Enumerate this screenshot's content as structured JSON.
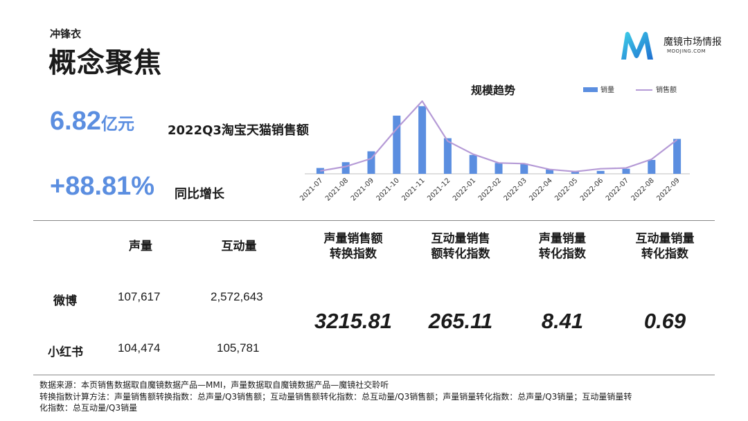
{
  "header": {
    "subtitle": "冲锋衣",
    "title": "概念聚焦",
    "logo_name": "魔镜市场情报",
    "logo_url": "MOOJING.COM",
    "logo_icon": "moojing-m-logo"
  },
  "kpis": {
    "sales_value": "6.82",
    "sales_unit": "亿元",
    "sales_label": "2022Q3淘宝天猫销售额",
    "growth_value": "+88.81%",
    "growth_label": "同比增长"
  },
  "chart_data": {
    "type": "bar",
    "title": "规模趋势",
    "legend_position": "top-right",
    "grid": false,
    "categories": [
      "2021-07",
      "2021-08",
      "2021-09",
      "2021-10",
      "2021-11",
      "2021-12",
      "2022-01",
      "2022-02",
      "2022-03",
      "2022-04",
      "2022-05",
      "2022-06",
      "2022-07",
      "2022-08",
      "2022-09"
    ],
    "ylim": [
      0,
      100
    ],
    "series": [
      {
        "name": "销量",
        "kind": "bar",
        "color": "#5b8ee0",
        "values": [
          8,
          16,
          31,
          80,
          93,
          49,
          26,
          15,
          14,
          6,
          4,
          4,
          7,
          19,
          48
        ]
      },
      {
        "name": "销售额",
        "kind": "line",
        "color": "#b59ad6",
        "values": [
          4,
          10,
          21,
          62,
          100,
          45,
          27,
          15,
          14,
          6,
          3,
          7,
          8,
          20,
          47
        ]
      }
    ]
  },
  "table": {
    "headers": {
      "voice": "声量",
      "interaction": "互动量",
      "col3_l1": "声量销售额",
      "col3_l2": "转换指数",
      "col4_l1": "互动量销售",
      "col4_l2": "额转化指数",
      "col5_l1": "声量销量",
      "col5_l2": "转化指数",
      "col6_l1": "互动量销量",
      "col6_l2": "转化指数"
    },
    "rows": [
      {
        "platform": "微博",
        "voice": "107,617",
        "interaction": "2,572,643"
      },
      {
        "platform": "小红书",
        "voice": "104,474",
        "interaction": "105,781"
      }
    ],
    "indices": {
      "voice_sales": "3215.81",
      "interaction_sales": "265.11",
      "voice_volume": "8.41",
      "interaction_volume": "0.69"
    }
  },
  "notes": {
    "line1": "数据来源：本页销售数据取自魔镜数据产品—MMI，声量数据取自魔镜数据产品—魔镜社交聆听",
    "line2": "转换指数计算方法：声量销售额转换指数：总声量/Q3销售额；互动量销售额转化指数：总互动量/Q3销售额；声量销量转化指数：总声量/Q3销量；互动量销量转",
    "line3": "化指数：总互动量/Q3销量"
  }
}
